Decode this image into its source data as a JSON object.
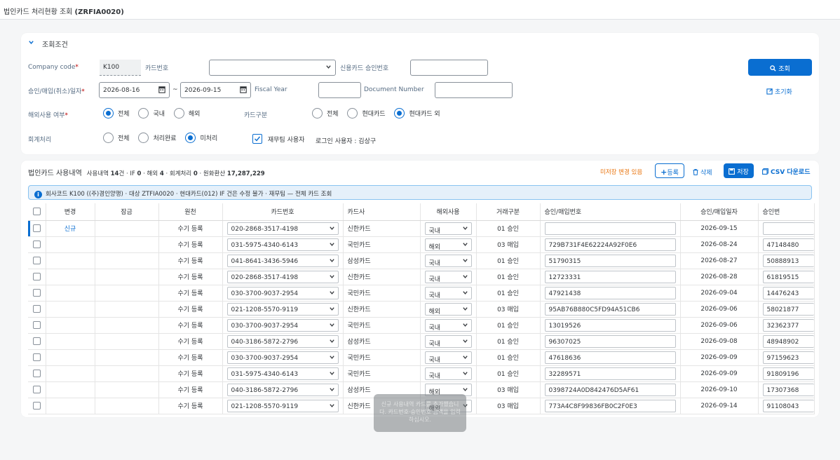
{
  "app": {
    "title": "법인카드 처리현황 조회",
    "code": "(ZRFIA0020)"
  },
  "filter": {
    "section_title": "조회조건",
    "company_code_label": "Company code",
    "company_code_value": "K100",
    "card_no_label": "카드번호",
    "approval_no_label": "신용카드 승인번호",
    "search_button": "조회",
    "date_label": "승인/매입(취소)일자",
    "date_from": "2026-08-16",
    "date_to": "2026-09-15",
    "fiscal_year_label": "Fiscal Year",
    "doc_no_label": "Document Number",
    "reset_link": "초기화",
    "overseas_label": "해외사용 여부",
    "overseas_options": [
      "전체",
      "국내",
      "해외"
    ],
    "card_type_label": "카드구분",
    "card_type_options": [
      "전체",
      "현대카드",
      "현대카드 외"
    ],
    "accounting_label": "회계처리",
    "accounting_options": [
      "전체",
      "처리완료",
      "미처리"
    ],
    "finance_user_label": "재무팀 사용자",
    "login_user": "로그인 사용자 : 김상구"
  },
  "list": {
    "title": "법인카드 사용내역",
    "summary_1": "사용내역",
    "count_total": "14",
    "summary_2": "건 · IF",
    "count_if": "0",
    "summary_3": " · 해외",
    "count_overseas": "4",
    "summary_4": " · 회계처리",
    "count_acc": "0",
    "summary_5": " · 원화환산",
    "total_krw": "17,287,229",
    "unsaved_text": "미저장 변경 있음",
    "add_button": "등록",
    "delete_button": "삭제",
    "save_button": "저장",
    "csv_button": "CSV 다운로드",
    "info_text": "회사코드 K100 ((주)경인양행) · 대상 ZTFIA0020 · 현대카드(012) IF 건은 수정 불가 · 재무팀 — 전체 카드 조회"
  },
  "table": {
    "headers": [
      "변경",
      "잠금",
      "원천",
      "카드번호",
      "카드사",
      "해외사용",
      "거래구분",
      "승인/매입번호",
      "승인/매입일자",
      "승인번"
    ],
    "rows": [
      {
        "change": "신규",
        "source": "수기 등록",
        "card": "020-2868-3517-4198",
        "issuer": "신한카드",
        "overseas": "국내",
        "type": "01 승인",
        "no": "",
        "date": "2026-09-15",
        "amt": ""
      },
      {
        "change": "",
        "source": "수기 등록",
        "card": "031-5975-4340-6143",
        "issuer": "국민카드",
        "overseas": "해외",
        "type": "03 매입",
        "no": "729B731F4E62224A92F0E6",
        "date": "2026-08-24",
        "amt": "47148480"
      },
      {
        "change": "",
        "source": "수기 등록",
        "card": "041-8641-3436-5946",
        "issuer": "삼성카드",
        "overseas": "국내",
        "type": "01 승인",
        "no": "51790315",
        "date": "2026-08-27",
        "amt": "50888913"
      },
      {
        "change": "",
        "source": "수기 등록",
        "card": "020-2868-3517-4198",
        "issuer": "신한카드",
        "overseas": "국내",
        "type": "01 승인",
        "no": "12723331",
        "date": "2026-08-28",
        "amt": "61819515"
      },
      {
        "change": "",
        "source": "수기 등록",
        "card": "030-3700-9037-2954",
        "issuer": "국민카드",
        "overseas": "국내",
        "type": "01 승인",
        "no": "47921438",
        "date": "2026-09-04",
        "amt": "14476243"
      },
      {
        "change": "",
        "source": "수기 등록",
        "card": "021-1208-5570-9119",
        "issuer": "신한카드",
        "overseas": "해외",
        "type": "03 매입",
        "no": "95AB76B880C5FD94A51CB6",
        "date": "2026-09-06",
        "amt": "58021877"
      },
      {
        "change": "",
        "source": "수기 등록",
        "card": "030-3700-9037-2954",
        "issuer": "국민카드",
        "overseas": "국내",
        "type": "01 승인",
        "no": "13019526",
        "date": "2026-09-06",
        "amt": "32362377"
      },
      {
        "change": "",
        "source": "수기 등록",
        "card": "040-3186-5872-2796",
        "issuer": "삼성카드",
        "overseas": "국내",
        "type": "01 승인",
        "no": "96307025",
        "date": "2026-09-08",
        "amt": "48948902"
      },
      {
        "change": "",
        "source": "수기 등록",
        "card": "030-3700-9037-2954",
        "issuer": "국민카드",
        "overseas": "국내",
        "type": "01 승인",
        "no": "47618636",
        "date": "2026-09-09",
        "amt": "97159623"
      },
      {
        "change": "",
        "source": "수기 등록",
        "card": "031-5975-4340-6143",
        "issuer": "국민카드",
        "overseas": "국내",
        "type": "01 승인",
        "no": "32289571",
        "date": "2026-09-09",
        "amt": "91809196"
      },
      {
        "change": "",
        "source": "수기 등록",
        "card": "040-3186-5872-2796",
        "issuer": "삼성카드",
        "overseas": "해외",
        "type": "03 매입",
        "no": "0398724A0D842476D5AF61",
        "date": "2026-09-10",
        "amt": "17307368"
      },
      {
        "change": "",
        "source": "수기 등록",
        "card": "021-1208-5570-9119",
        "issuer": "신한카드",
        "overseas": "해외",
        "type": "03 매입",
        "no": "773A4C8F99836FB0C2F0E3",
        "date": "2026-09-14",
        "amt": "91108043"
      }
    ]
  },
  "toast": "신규 사용내역 카드를 추가했습니다. 카드번호·승인번호·금액을 입력하십시오.",
  "colors": {
    "accent": "#0a6ed1",
    "required": "#bb0000",
    "warning": "#e9730c"
  }
}
